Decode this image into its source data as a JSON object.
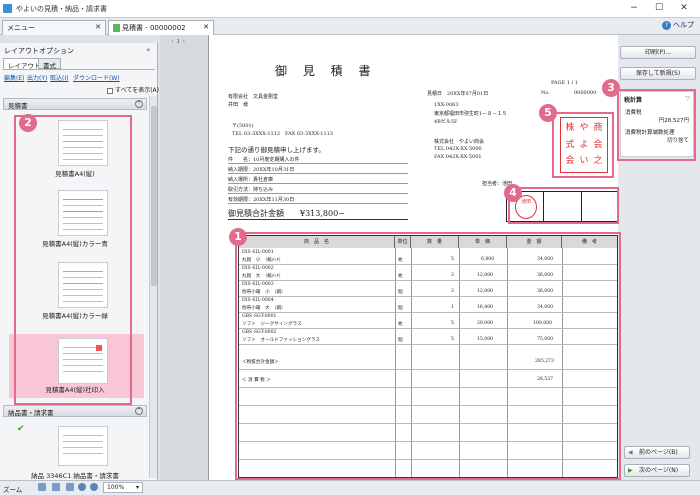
{
  "window": {
    "title": "やよいの見積・納品・請求書"
  },
  "tabs": [
    {
      "label": "メニュー"
    },
    {
      "label": "見積書 - 00000002"
    }
  ],
  "help_label": "ヘルプ",
  "left_panel": {
    "title": "レイアウトオプション",
    "subtabs": [
      "レイアウト",
      "書式"
    ],
    "links": [
      "編集(E)",
      "出力(Y)",
      "取込(I)",
      "ダウンロード(W)"
    ],
    "show_all": "すべてを表示(A)",
    "section1": "見積書",
    "section2": "納品書・請求書",
    "items": [
      {
        "label": "見積書A4(縦)"
      },
      {
        "label": "見積書A4(縦)カラー青"
      },
      {
        "label": "見積書A4(縦)カラー緑"
      },
      {
        "label": "見積書A4(縦)社印入"
      },
      {
        "label": "納品 3346C1 納品書・請求書"
      }
    ]
  },
  "status": {
    "zoom_label": "ズーム",
    "zoom_value": "100%"
  },
  "ruler": "・ 1 ・",
  "right_panel": {
    "print_button": "印刷(P)...",
    "save_button": "保存して新規(S)",
    "tax_title": "税計算",
    "tax_items": [
      "消費税",
      "円28,527円",
      "消費税計算端数処理",
      "切り捨て"
    ],
    "prev_page": "前のページ(B)",
    "next_page": "次のページ(N)"
  },
  "document": {
    "title": "御 見 積 書",
    "page": "PAGE    1 / 1",
    "date": "見積日　20XX年07月01日",
    "no_label": "No.",
    "no_value": "0000000",
    "customer_company": "有限会社　文具金剛堂",
    "customer_attn": "井田　様",
    "customer_zip": "〒(5001)",
    "customer_tel": "TEL 03-3XXX-1112　FAX 03-3XXX-1113",
    "issuer_zip": "1XX-0063",
    "issuer_addr1": "東京都福田市弥生町1－８－１５",
    "issuer_addr2": "4Bビル5F",
    "issuer_name": "株式会社　やよい商会",
    "issuer_tel": "TEL 042X-XX-5000",
    "issuer_fax": "FAX 042X-XX-5001",
    "greeting": "下記の通り御見積申し上げます。",
    "meta": [
      "件　　名：10月度定期購入の件",
      "納入期限：20XX年10月31日",
      "納入場所：貴社倉庫",
      "取引方法：持ち込み",
      "有効期限：20XX年11月30日"
    ],
    "total_label": "御見積合計金額",
    "total_value": "¥313,800−",
    "person_label": "担当者：池田",
    "stamp_name": "池田",
    "seal_chars": [
      "株",
      "や",
      "商",
      "式",
      "よ",
      "会",
      "会",
      "い",
      "之",
      "社",
      "",
      "印"
    ],
    "columns": [
      "商　品　名",
      "単位",
      "数　量",
      "単　価",
      "金　額",
      "備　考"
    ],
    "rows": [
      {
        "code": "DIS-SIL-0001",
        "name": "丸廻　小　（紙ﾒｯｷ）",
        "unit": "枚",
        "qty": "5",
        "price": "6,800",
        "amount": "34,000"
      },
      {
        "code": "DIS-SIL-0002",
        "name": "丸廻　大　（紙ﾒｯｷ）",
        "unit": "枚",
        "qty": "3",
        "price": "12,000",
        "amount": "36,000"
      },
      {
        "code": "DIS-SIL-0003",
        "name": "他帯小箱　小　（鋼）",
        "unit": "個",
        "qty": "3",
        "price": "12,000",
        "amount": "36,000"
      },
      {
        "code": "DIS-SIL-0004",
        "name": "他帯小箱　大　（鋼）",
        "unit": "個",
        "qty": "1",
        "price": "16,400",
        "amount": "34,000"
      },
      {
        "code": "GBS-SGT-0001",
        "name": "ソフト　ジーグサイングラス",
        "unit": "枚",
        "qty": "5",
        "price": "20,000",
        "amount": "100,000"
      },
      {
        "code": "GBS-SGT-0002",
        "name": "ソフト　オールドファッショングラス",
        "unit": "個",
        "qty": "5",
        "price": "15,000",
        "amount": "75,000"
      }
    ],
    "subtotal_label": "＜税抜合計金額＞",
    "subtotal_value": "285,273",
    "tax_label": "＜ 消 費 税 ＞",
    "tax_value": "28,527"
  },
  "badges": [
    "1",
    "2",
    "3",
    "4",
    "5"
  ],
  "highlight_color": "#e26b8c"
}
